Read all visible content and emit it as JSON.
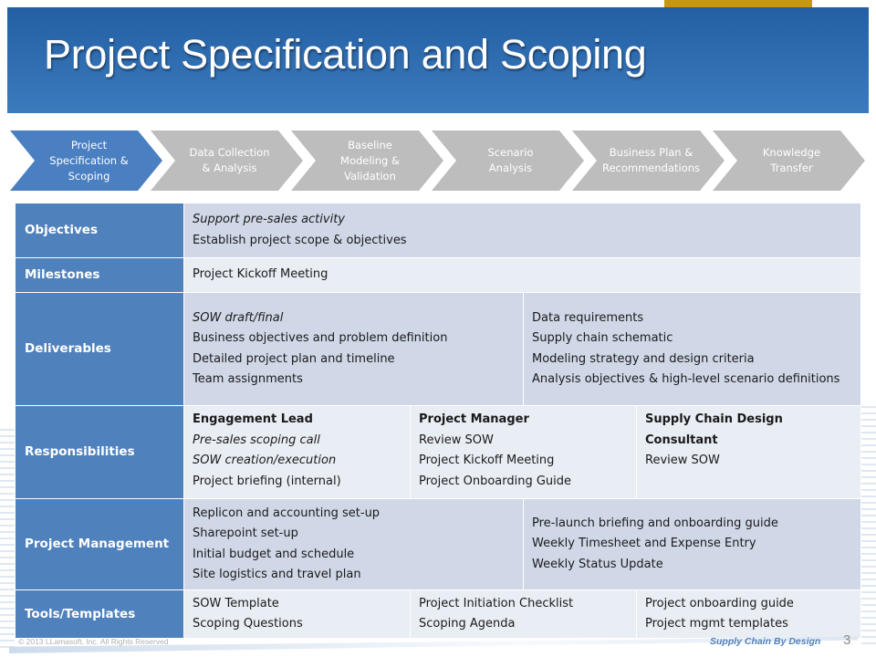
{
  "slide": {
    "title": "Project Specification and Scoping",
    "accent_color": "#c9960c",
    "header_color": "#2f6db0"
  },
  "process": {
    "steps": [
      {
        "label": "Project Specification & Scoping",
        "active": true
      },
      {
        "label": "Data Collection & Analysis",
        "active": false
      },
      {
        "label": "Baseline Modeling & Validation",
        "active": false
      },
      {
        "label": "Scenario Analysis",
        "active": false
      },
      {
        "label": "Business Plan & Recommendations",
        "active": false
      },
      {
        "label": "Knowledge Transfer",
        "active": false
      }
    ]
  },
  "table": {
    "objectives": {
      "header": "Objectives",
      "lines": [
        "Support pre-sales activity",
        "Establish project scope & objectives"
      ]
    },
    "milestones": {
      "header": "Milestones",
      "lines": [
        "Project Kickoff Meeting"
      ]
    },
    "deliverables": {
      "header": "Deliverables",
      "left": [
        "SOW draft/final",
        "Business objectives and problem definition",
        "Detailed project plan and timeline",
        "Team assignments"
      ],
      "right": [
        "Data requirements",
        "Supply chain schematic",
        "Modeling strategy and design criteria",
        "Analysis objectives & high-level scenario definitions"
      ]
    },
    "responsibilities": {
      "header": "Responsibilities",
      "roles": [
        {
          "role": "Engagement Lead",
          "items": [
            "Pre-sales scoping call",
            "SOW creation/execution",
            "Project briefing (internal)"
          ]
        },
        {
          "role": "Project Manager",
          "items": [
            "Review SOW",
            "Project Kickoff Meeting",
            "Project Onboarding Guide"
          ]
        },
        {
          "role": "Supply Chain Design Consultant",
          "items": [
            "Review SOW"
          ]
        }
      ]
    },
    "project_management": {
      "header": "Project Management",
      "left": [
        "Replicon and accounting set-up",
        "Sharepoint set-up",
        "Initial budget and schedule",
        "Site logistics and travel plan"
      ],
      "right": [
        "Pre-launch briefing and onboarding guide",
        "Weekly Timesheet and Expense Entry",
        "Weekly Status Update"
      ]
    },
    "tools": {
      "header": "Tools/Templates",
      "col1": [
        "SOW Template",
        "Scoping Questions"
      ],
      "col2": [
        "Project Initiation Checklist",
        "Scoping Agenda"
      ],
      "col3": [
        "Project onboarding guide",
        "Project mgmt templates"
      ]
    }
  },
  "footer": {
    "copyright": "© 2013 LLamasoft, Inc. All Rights Reserved",
    "tagline": "Supply Chain By Design",
    "page_number": "3"
  }
}
